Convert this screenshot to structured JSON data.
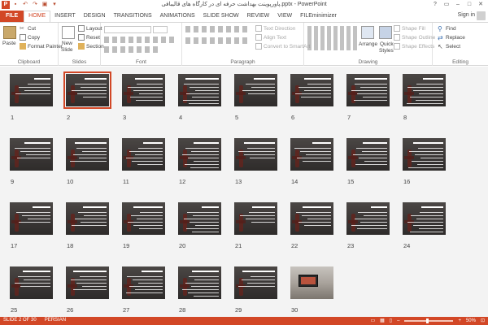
{
  "window": {
    "title": "پاورپوینت بهداشت حرفه ای در کارگاه های قالیبافی.pptx - PowerPoint",
    "controls": [
      "?",
      "▭",
      "–",
      "□",
      "✕"
    ]
  },
  "qat": {
    "logo": "P",
    "save": "▪",
    "undo": "↶",
    "redo": "↷",
    "start": "▣",
    "more": "▾"
  },
  "tabs": {
    "file": "FILE",
    "home": "HOME",
    "insert": "INSERT",
    "design": "DESIGN",
    "transitions": "TRANSITIONS",
    "animations": "ANIMATIONS",
    "slideshow": "SLIDE SHOW",
    "review": "REVIEW",
    "view": "VIEW",
    "fileminimizer": "FILEminimizer",
    "signin": "Sign in"
  },
  "ribbon": {
    "clipboard": {
      "paste": "Paste",
      "cut": "Cut",
      "copy": "Copy",
      "format_painter": "Format Painter",
      "label": "Clipboard"
    },
    "slides": {
      "new_slide": "New",
      "new_slide2": "Slide",
      "layout": "Layout",
      "reset": "Reset",
      "section": "Section",
      "label": "Slides"
    },
    "font": {
      "label": "Font"
    },
    "paragraph": {
      "text_direction": "Text Direction",
      "align_text": "Align Text",
      "convert": "Convert to SmartArt",
      "label": "Paragraph"
    },
    "drawing": {
      "arrange": "Arrange",
      "quick": "Quick",
      "styles": "Styles",
      "shape_fill": "Shape Fill",
      "shape_outline": "Shape Outline",
      "shape_effects": "Shape Effects",
      "label": "Drawing"
    },
    "editing": {
      "find": "Find",
      "replace": "Replace",
      "select": "Select",
      "label": "Editing"
    }
  },
  "slides": [
    {
      "num": "1"
    },
    {
      "num": "2"
    },
    {
      "num": "3"
    },
    {
      "num": "4"
    },
    {
      "num": "5"
    },
    {
      "num": "6"
    },
    {
      "num": "7"
    },
    {
      "num": "8"
    },
    {
      "num": "9"
    },
    {
      "num": "10"
    },
    {
      "num": "11"
    },
    {
      "num": "12"
    },
    {
      "num": "13"
    },
    {
      "num": "14"
    },
    {
      "num": "15"
    },
    {
      "num": "16"
    },
    {
      "num": "17"
    },
    {
      "num": "18"
    },
    {
      "num": "19"
    },
    {
      "num": "20"
    },
    {
      "num": "21"
    },
    {
      "num": "22"
    },
    {
      "num": "23"
    },
    {
      "num": "24"
    },
    {
      "num": "25"
    },
    {
      "num": "26"
    },
    {
      "num": "27"
    },
    {
      "num": "28"
    },
    {
      "num": "29"
    },
    {
      "num": "30"
    }
  ],
  "selected_slide": "2",
  "status": {
    "slide_info": "SLIDE 2 OF 30",
    "language": "PERSIAN",
    "zoom": "50%"
  },
  "colors": {
    "accent": "#d24726"
  }
}
